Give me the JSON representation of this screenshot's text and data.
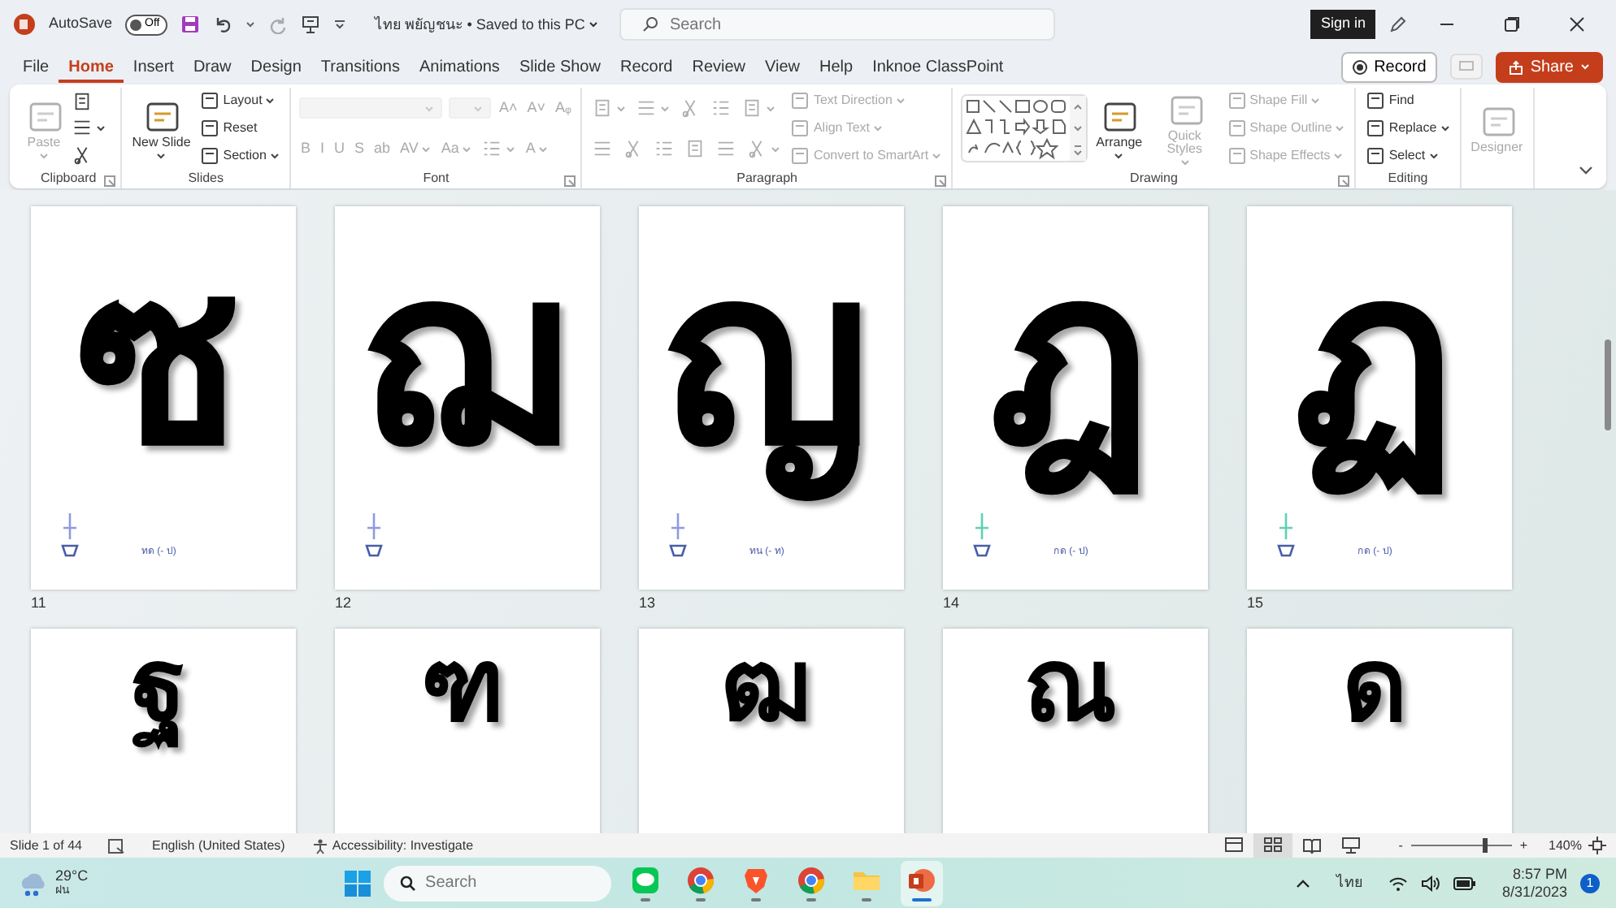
{
  "title_bar": {
    "autosave_label": "AutoSave",
    "autosave": {
      "text": "Off",
      "on": false
    },
    "document_title": "ไทย พยัญชนะ • Saved to this PC",
    "search": {
      "placeholder": "Search"
    },
    "sign_in": "Sign in"
  },
  "menu_tabs": [
    {
      "label": "File",
      "selected": false
    },
    {
      "label": "Home",
      "selected": true
    },
    {
      "label": "Insert",
      "selected": false
    },
    {
      "label": "Draw",
      "selected": false
    },
    {
      "label": "Design",
      "selected": false
    },
    {
      "label": "Transitions",
      "selected": false
    },
    {
      "label": "Animations",
      "selected": false
    },
    {
      "label": "Slide Show",
      "selected": false
    },
    {
      "label": "Record",
      "selected": false
    },
    {
      "label": "Review",
      "selected": false
    },
    {
      "label": "View",
      "selected": false
    },
    {
      "label": "Help",
      "selected": false
    },
    {
      "label": "Inknoe ClassPoint",
      "selected": false
    }
  ],
  "record_button": "Record",
  "share_button": "Share",
  "ribbon": [
    {
      "label": "Clipboard",
      "launcher": true,
      "columns": [
        [
          [
            {
              "kind": "large",
              "label": "Paste",
              "disabled": true,
              "dropdown": true
            }
          ]
        ],
        [
          [
            {
              "kind": "icon",
              "disabled": false
            }
          ],
          [
            {
              "kind": "icon",
              "disabled": false,
              "dropdown": true
            }
          ],
          [
            {
              "kind": "icon",
              "disabled": false
            }
          ]
        ]
      ]
    },
    {
      "label": "Slides",
      "columns": [
        [
          [
            {
              "kind": "large",
              "label": "New Slide",
              "disabled": false,
              "dropdown": true
            }
          ]
        ],
        [
          [
            {
              "kind": "small",
              "label": "Layout",
              "disabled": false,
              "dropdown": true
            }
          ],
          [
            {
              "kind": "small",
              "label": "Reset",
              "disabled": false
            }
          ],
          [
            {
              "kind": "small",
              "label": "Section",
              "disabled": false,
              "dropdown": true
            }
          ]
        ]
      ]
    },
    {
      "label": "Font",
      "launcher": true,
      "columns": [
        [
          [
            {
              "kind": "wide-field",
              "disabled": true
            },
            {
              "kind": "narrow-field",
              "disabled": true
            },
            {
              "kind": "glyph",
              "text": "A˄",
              "disabled": true
            },
            {
              "kind": "glyph",
              "text": "A˅",
              "disabled": true
            },
            {
              "kind": "glyph",
              "text": "Aᵩ",
              "disabled": true
            }
          ],
          [
            {
              "kind": "glyph",
              "text": "B",
              "disabled": true
            },
            {
              "kind": "glyph",
              "text": "I",
              "disabled": true
            },
            {
              "kind": "glyph",
              "text": "U",
              "disabled": true
            },
            {
              "kind": "glyph",
              "text": "S",
              "disabled": true
            },
            {
              "kind": "glyph",
              "text": "ab",
              "disabled": true
            },
            {
              "kind": "glyph",
              "text": "AV",
              "disabled": true,
              "dropdown": true
            },
            {
              "kind": "glyph",
              "text": "Aa",
              "disabled": true,
              "dropdown": true
            },
            {
              "kind": "icon",
              "disabled": true,
              "dropdown": true
            },
            {
              "kind": "glyph",
              "text": "A",
              "disabled": true,
              "dropdown": true
            }
          ]
        ]
      ]
    },
    {
      "label": "Paragraph",
      "launcher": true,
      "columns": [
        [
          [
            {
              "kind": "icon",
              "disabled": true,
              "dropdown": true
            },
            {
              "kind": "icon",
              "disabled": true,
              "dropdown": true
            },
            {
              "kind": "icon",
              "disabled": true
            },
            {
              "kind": "icon",
              "disabled": true
            },
            {
              "kind": "icon",
              "disabled": true,
              "dropdown": true
            }
          ],
          [
            {
              "kind": "icon",
              "disabled": true
            },
            {
              "kind": "icon",
              "disabled": true
            },
            {
              "kind": "icon",
              "disabled": true
            },
            {
              "kind": "icon",
              "disabled": true
            },
            {
              "kind": "icon",
              "disabled": true
            },
            {
              "kind": "icon",
              "disabled": true,
              "dropdown": true
            }
          ]
        ],
        [
          [
            {
              "kind": "small",
              "label": "Text Direction",
              "disabled": true,
              "dropdown": true
            }
          ],
          [
            {
              "kind": "small",
              "label": "Align Text",
              "disabled": true,
              "dropdown": true
            }
          ],
          [
            {
              "kind": "small",
              "label": "Convert to SmartArt",
              "disabled": true,
              "dropdown": true
            }
          ]
        ]
      ]
    },
    {
      "label": "Drawing",
      "launcher": true,
      "columns": [
        [
          [
            {
              "kind": "gallery"
            }
          ]
        ],
        [
          [
            {
              "kind": "large",
              "label": "Arrange",
              "disabled": false,
              "dropdown": true
            }
          ]
        ],
        [
          [
            {
              "kind": "large",
              "label": "Quick Styles",
              "disabled": true,
              "dropdown": true
            }
          ]
        ],
        [
          [
            {
              "kind": "small",
              "label": "Shape Fill",
              "disabled": true,
              "dropdown": true
            }
          ],
          [
            {
              "kind": "small",
              "label": "Shape Outline",
              "disabled": true,
              "dropdown": true
            }
          ],
          [
            {
              "kind": "small",
              "label": "Shape Effects",
              "disabled": true,
              "dropdown": true
            }
          ]
        ]
      ]
    },
    {
      "label": "Editing",
      "columns": [
        [
          [
            {
              "kind": "small",
              "label": "Find",
              "disabled": false
            }
          ],
          [
            {
              "kind": "small",
              "label": "Replace",
              "disabled": false,
              "dropdown": true
            }
          ],
          [
            {
              "kind": "small",
              "label": "Select",
              "disabled": false,
              "dropdown": true
            }
          ]
        ]
      ]
    },
    {
      "columns": [
        [
          [
            {
              "kind": "large",
              "label": "Designer",
              "disabled": true
            }
          ]
        ]
      ]
    }
  ],
  "slides": [
    {
      "number": "11",
      "glyph": "ซ",
      "caption": "ทด (- ป)",
      "color": "#8e9ae0"
    },
    {
      "number": "12",
      "glyph": "ฌ",
      "color": "#8e9ae0"
    },
    {
      "number": "13",
      "glyph": "ญ",
      "caption": "ทน (- ท)",
      "color": "#8e9ae0"
    },
    {
      "number": "14",
      "glyph": "ฎ",
      "caption": "กด (- ป)",
      "color": "#5fd1b5"
    },
    {
      "number": "15",
      "glyph": "ฏ",
      "caption": "กด (- ป)",
      "color": "#5fd1b5"
    },
    {
      "glyph": "ฐ"
    },
    {
      "glyph": "ฑ"
    },
    {
      "glyph": "ฒ"
    },
    {
      "glyph": "ณ"
    },
    {
      "glyph": "ด"
    }
  ],
  "status_bar": {
    "slide_count": "Slide 1 of 44",
    "language": "English (United States)",
    "accessibility": "Accessibility: Investigate",
    "views": [
      {
        "selected": false
      },
      {
        "selected": true
      },
      {
        "selected": false
      },
      {
        "selected": false
      }
    ],
    "zoom_out": "-",
    "zoom_in": "+",
    "zoom": {
      "level": 0.72
    },
    "zoom_text": "140%"
  },
  "taskbar": {
    "temperature": "29°C",
    "weather": "ฝน",
    "search": {
      "placeholder": "Search"
    },
    "apps": [
      {
        "kind": "chat",
        "selected": false
      },
      {
        "kind": "browser",
        "selected": false
      },
      {
        "kind": "shield",
        "selected": false
      },
      {
        "kind": "browser",
        "selected": false
      },
      {
        "kind": "folder",
        "selected": false
      },
      {
        "kind": "presentation",
        "selected": true
      }
    ],
    "language": "ไทย",
    "time": "8:57 PM",
    "date": "8/31/2023",
    "notifications": "1"
  }
}
